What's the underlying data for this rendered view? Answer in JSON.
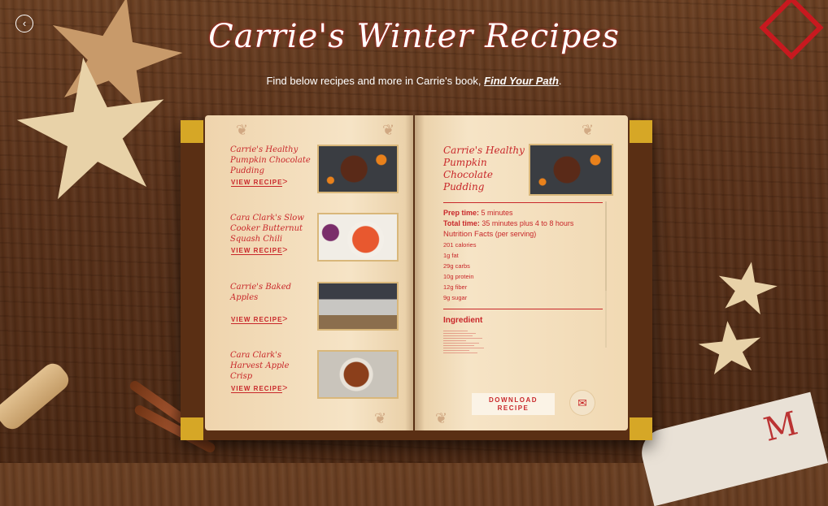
{
  "header": {
    "title": "Carrie's Winter Recipes",
    "subtitle_prefix": "Find below recipes  and more in Carrie's book, ",
    "book_link": "Find Your Path",
    "subtitle_suffix": "."
  },
  "nav": {
    "back_icon": "‹"
  },
  "recipes": [
    {
      "name": "Carrie's Healthy Pumpkin Chocolate Pudding",
      "view_label": "VIEW RECIPE",
      "chevron": ">"
    },
    {
      "name": "Cara Clark's Slow Cooker Butternut Squash Chili",
      "view_label": "VIEW RECIPE",
      "chevron": ">"
    },
    {
      "name": "Carrie's Baked Apples",
      "view_label": "VIEW RECIPE",
      "chevron": ">"
    },
    {
      "name": "Cara Clark's Harvest Apple Crisp",
      "view_label": "VIEW RECIPE",
      "chevron": ">"
    }
  ],
  "detail": {
    "title": "Carrie's Healthy Pumpkin Chocolate Pudding",
    "prep_label": "Prep time:",
    "prep_value": " 5 minutes",
    "total_label": "Total time:",
    "total_value": " 35 minutes plus 4 to 8 hours",
    "nutrition_label": "Nutrition Facts",
    "nutrition_note": " (per serving)",
    "facts": [
      "201 calories",
      "1g fat",
      "29g carbs",
      "10g protein",
      "12g fiber",
      "9g sugar"
    ],
    "ingredient_title": "Ingredient",
    "download_label": "DOWNLOAD RECIPE",
    "mail_icon": "✉"
  }
}
